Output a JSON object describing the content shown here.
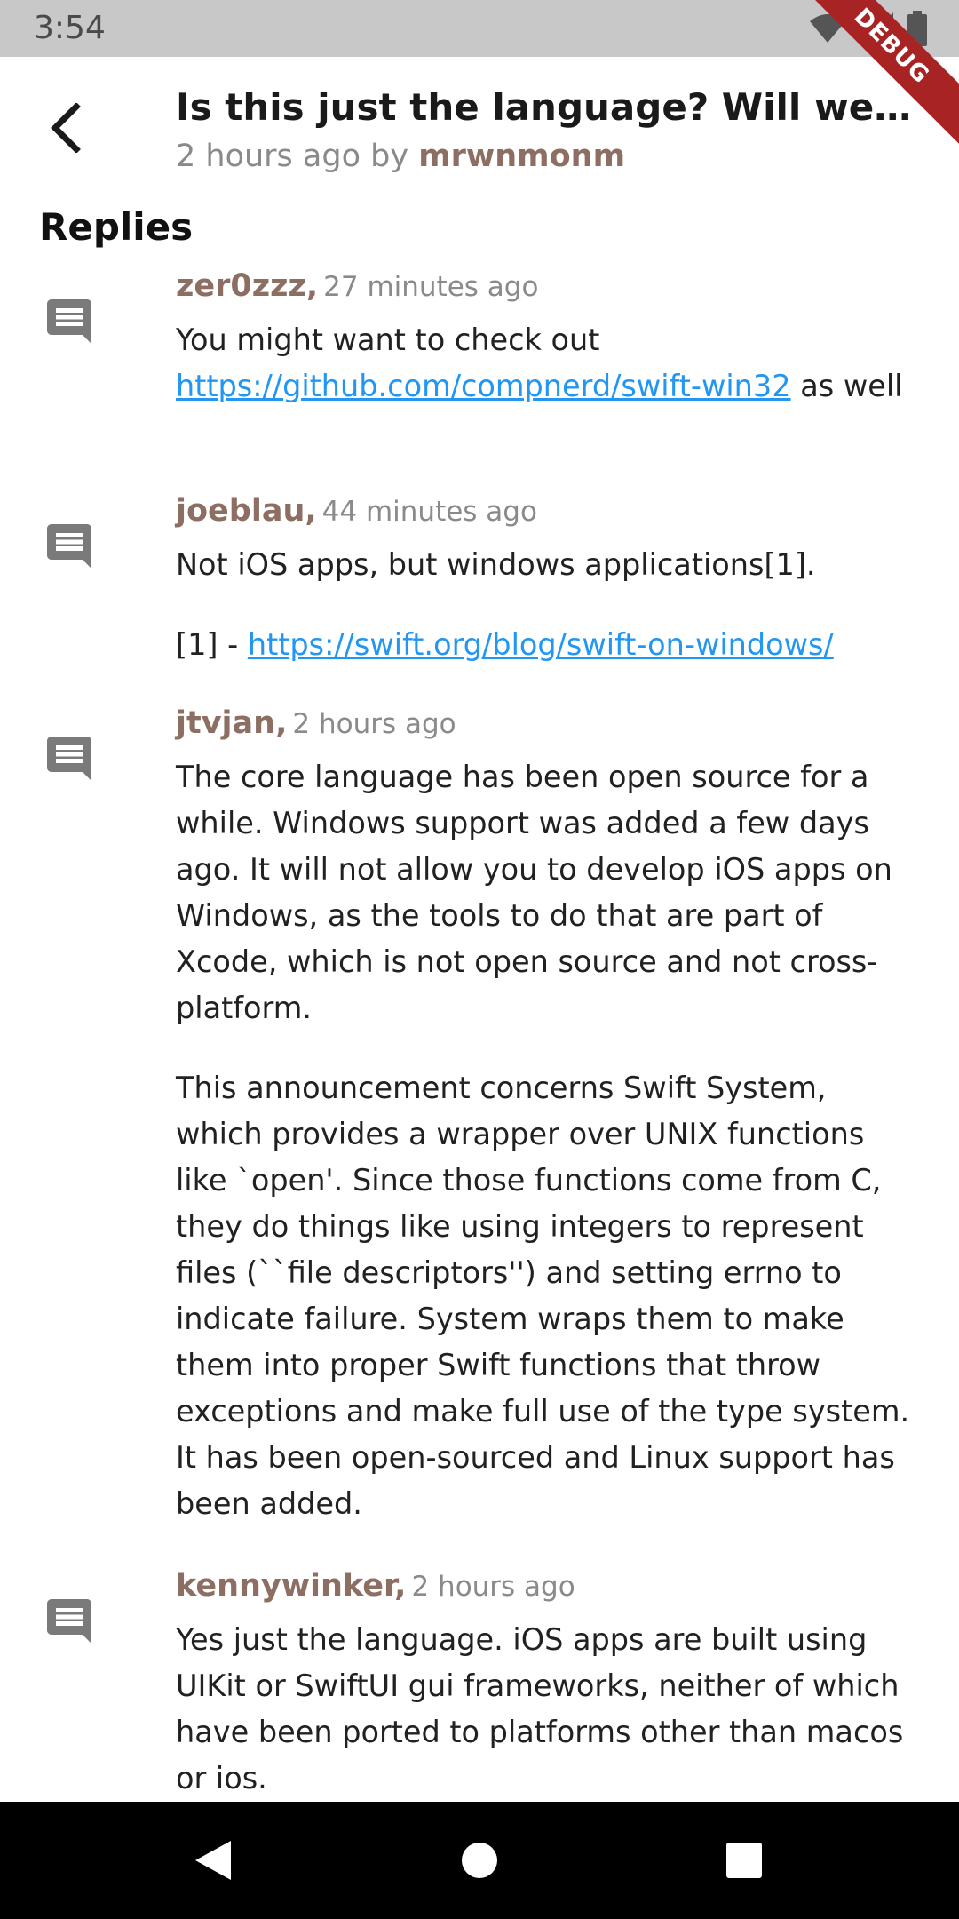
{
  "status_bar": {
    "time": "3:54",
    "icons": [
      "wifi-icon",
      "signal-icon",
      "battery-icon"
    ]
  },
  "debug_banner": "DEBUG",
  "header": {
    "title": "Is this just the language? Will we be able to build iOS apps on Windows?",
    "subtitle_prefix": "2 hours ago by ",
    "author": "mrwnmonm"
  },
  "replies_heading": "Replies",
  "comments": [
    {
      "user": "zer0zzz,",
      "time": "27 minutes ago",
      "paragraphs": [
        [
          "You might want to check out ",
          "https://github.com/compnerd/swift-win32",
          " as well"
        ]
      ]
    },
    {
      "user": "joeblau,",
      "time": "44 minutes ago",
      "paragraphs": [
        [
          "Not iOS apps, but windows applications[1]."
        ],
        [
          "[1] - ",
          "https://swift.org/blog/swift-on-windows/"
        ]
      ]
    },
    {
      "user": "jtvjan,",
      "time": "2 hours ago",
      "paragraphs": [
        [
          "The core language has been open source for a while. Windows support was added a few days ago. It will not allow you to develop iOS apps on Windows, as the tools to do that are part of Xcode, which is not open source and not cross-platform."
        ],
        [
          "This announcement concerns Swift System, which provides a wrapper over UNIX functions like `open'. Since those functions come from C, they do things like using integers to represent files (``file descriptors'') and setting errno to indicate failure. System wraps them to make them into proper Swift functions that throw exceptions and make full use of the type system. It has been open-sourced and Linux support has been added."
        ]
      ]
    },
    {
      "user": "kennywinker,",
      "time": "2 hours ago",
      "paragraphs": [
        [
          "Yes just the language. iOS apps are built using UIKit or SwiftUI gui frameworks, neither of which have been ported to platforms other than macos or ios."
        ]
      ]
    }
  ],
  "colors": {
    "author": "#8d6e63",
    "link": "#2196f3",
    "status_bar": "#c8c8c8",
    "debug_ribbon": "#a82424"
  },
  "nav_bar": {
    "icons": [
      "back-triangle-icon",
      "home-circle-icon",
      "recents-square-icon"
    ]
  }
}
